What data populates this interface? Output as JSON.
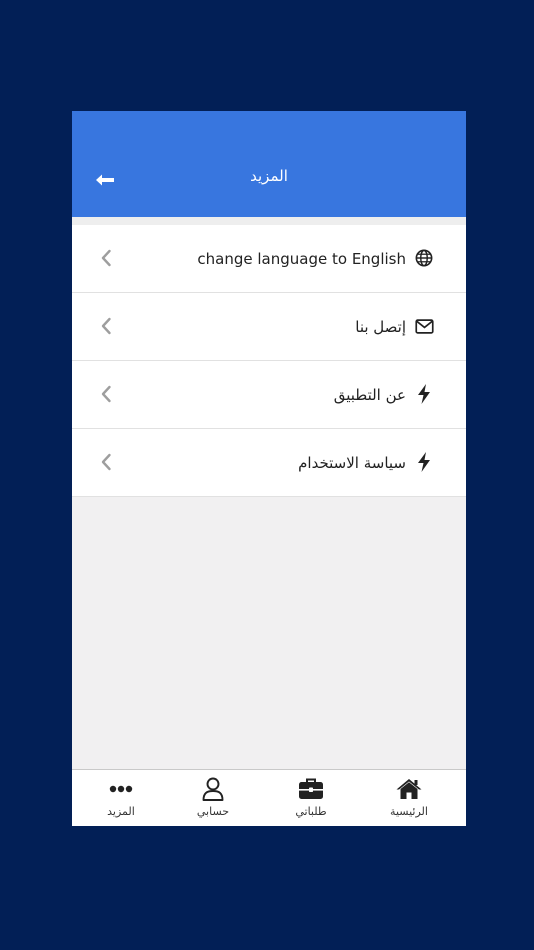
{
  "header": {
    "title": "المزيد",
    "back_icon": "arrow-left-icon"
  },
  "menu": [
    {
      "label": "change language to English",
      "icon": "globe-icon",
      "dir": "ltr"
    },
    {
      "label": "إتصل بنا",
      "icon": "envelope-icon",
      "dir": "rtl"
    },
    {
      "label": "عن التطبيق",
      "icon": "bolt-icon",
      "dir": "rtl"
    },
    {
      "label": "سياسة الاستخدام",
      "icon": "bolt-icon",
      "dir": "rtl"
    }
  ],
  "tabs": [
    {
      "label": "الرئيسية",
      "icon": "home-icon"
    },
    {
      "label": "طلباتي",
      "icon": "briefcase-icon"
    },
    {
      "label": "حسابي",
      "icon": "user-icon"
    },
    {
      "label": "المزيد",
      "icon": "more-dots-icon"
    }
  ],
  "colors": {
    "background": "#021f56",
    "header": "#3876df",
    "content": "#f1f0f1"
  }
}
